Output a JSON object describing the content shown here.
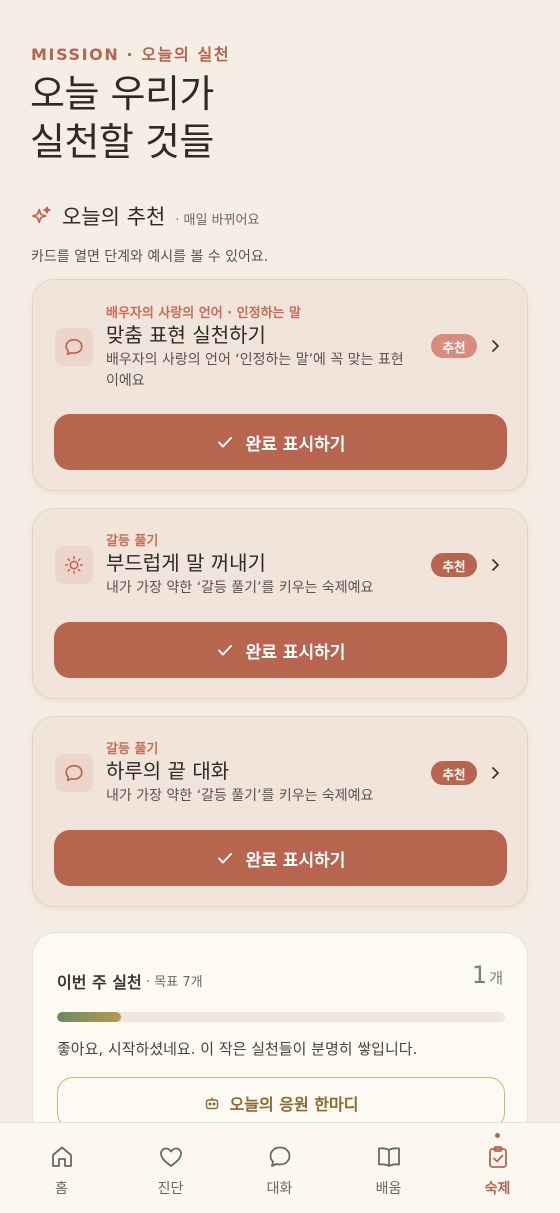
{
  "header": {
    "eyebrow": "MISSION · 오늘의 실천",
    "title_line1": "오늘 우리가",
    "title_line2": "실천할 것들"
  },
  "section": {
    "icon": "sparkle-icon",
    "title": "오늘의 추천",
    "subtitle": "· 매일 바뀌어요",
    "hint": "카드를 열면 단계와 예시를 볼 수 있어요."
  },
  "cards": [
    {
      "icon": "speech-bubble-icon",
      "category": "배우자의 사랑의 언어 · 인정하는 말",
      "title": "맞춤 표현 실천하기",
      "description": "배우자의 사랑의 언어 ‘인정하는 말’에 꼭 맞는 표현이에요",
      "badge": "추천",
      "badge_color": "#d88c7d",
      "button_label": "완료 표시하기"
    },
    {
      "icon": "sun-icon",
      "category": "갈등 풀기",
      "title": "부드럽게 말 꺼내기",
      "description": "내가 가장 약한 ‘갈등 풀기’를 키우는 숙제예요",
      "badge": "추천",
      "badge_color": "#b86550",
      "button_label": "완료 표시하기"
    },
    {
      "icon": "speech-bubble-icon",
      "category": "갈등 풀기",
      "title": "하루의 끝 대화",
      "description": "내가 가장 약한 ‘갈등 풀기’를 키우는 숙제예요",
      "badge": "추천",
      "badge_color": "#b86550",
      "button_label": "완료 표시하기"
    }
  ],
  "weekly": {
    "title": "이번 주 실천",
    "goal": "· 목표 7개",
    "count": "1",
    "count_unit": "개",
    "progress_fraction": 0.143,
    "message": "좋아요, 시작하셨네요. 이 작은 실천들이 분명히 쌓입니다.",
    "cheer_button": "오늘의 응원 한마디"
  },
  "nav": [
    {
      "label": "홈",
      "icon": "home-icon",
      "active": false
    },
    {
      "label": "진단",
      "icon": "heart-icon",
      "active": false
    },
    {
      "label": "대화",
      "icon": "chat-icon",
      "active": false
    },
    {
      "label": "배움",
      "icon": "book-icon",
      "active": false
    },
    {
      "label": "숙제",
      "icon": "clipboard-check-icon",
      "active": true
    }
  ],
  "colors": {
    "background": "#f5eee4",
    "accent": "#b86550",
    "card": "#f1e4da",
    "progress_start": "#6c8a62",
    "progress_end": "#b79a50"
  }
}
